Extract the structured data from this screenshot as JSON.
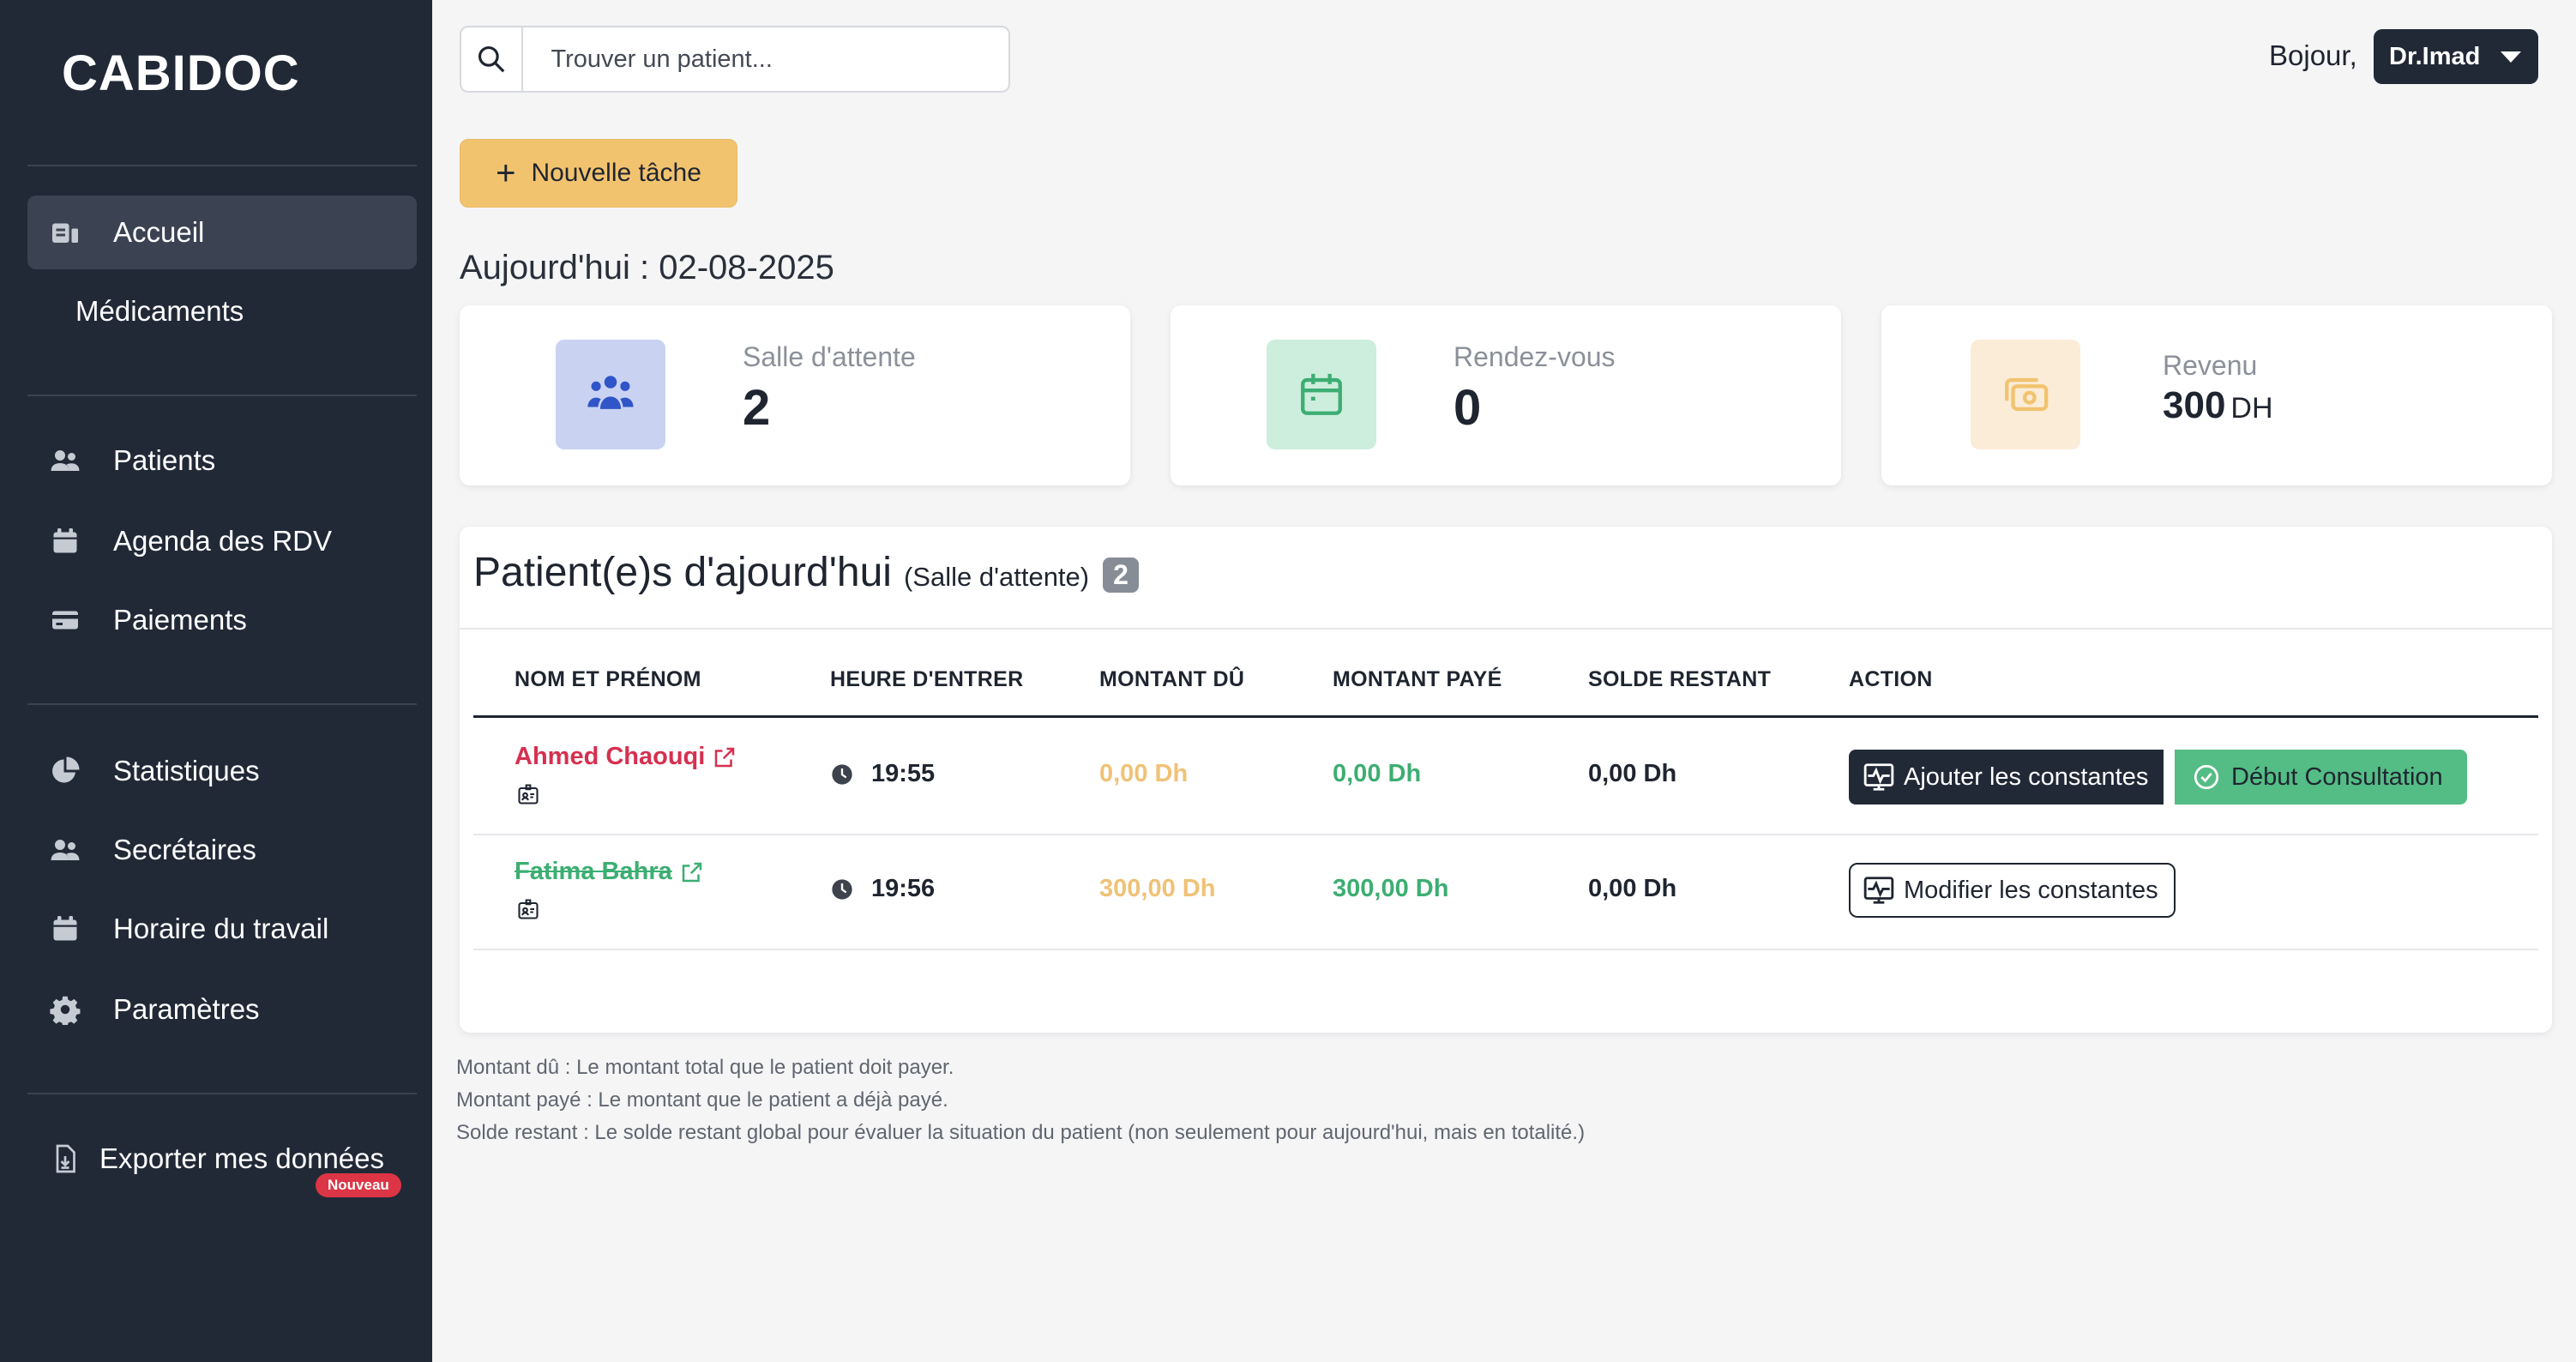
{
  "sidebar": {
    "brand": "CABIDOC",
    "items": [
      {
        "label": "Accueil",
        "icon": "home-card-icon"
      },
      {
        "label": "Médicaments"
      },
      {
        "label": "Patients",
        "icon": "users-icon"
      },
      {
        "label": "Agenda des RDV",
        "icon": "calendar-icon"
      },
      {
        "label": "Paiements",
        "icon": "credit-card-icon"
      },
      {
        "label": "Statistiques",
        "icon": "pie-chart-icon"
      },
      {
        "label": "Secrétaires",
        "icon": "users-icon"
      },
      {
        "label": "Horaire du travail",
        "icon": "calendar-icon"
      },
      {
        "label": "Paramètres",
        "icon": "gear-icon"
      },
      {
        "label": "Exporter mes données",
        "icon": "file-download-icon",
        "badge": "Nouveau"
      }
    ]
  },
  "topbar": {
    "search_placeholder": "Trouver un patient...",
    "greeting": "Bojour,",
    "user": "Dr.Imad"
  },
  "actions": {
    "new_task": "Nouvelle tâche"
  },
  "today_label": "Aujourd'hui : 02-08-2025",
  "stats": [
    {
      "label": "Salle d'attente",
      "value": "2",
      "icon": "users-group-icon",
      "bg": "#c9d3f1",
      "fg": "#2f55c8"
    },
    {
      "label": "Rendez-vous",
      "value": "0",
      "icon": "calendar-icon",
      "bg": "#cdeedd",
      "fg": "#3cae72"
    },
    {
      "label": "Revenu",
      "value": "300",
      "unit": "DH",
      "icon": "money-icon",
      "bg": "#fbecd8",
      "fg": "#f2c36f"
    }
  ],
  "panel": {
    "title": "Patient(e)s d'ajourd'hui",
    "subtitle": "(Salle d'attente)",
    "count": "2",
    "columns": [
      "NOM ET PRÉNOM",
      "HEURE D'ENTRER",
      "MONTANT DÛ",
      "MONTANT PAYÉ",
      "SOLDE RESTANT",
      "ACTION"
    ],
    "rows": [
      {
        "name": "Ahmed Chaouqi",
        "time": "19:55",
        "due": "0,00 Dh",
        "paid": "0,00 Dh",
        "rest": "0,00 Dh",
        "action1": "Ajouter les constantes",
        "action2": "Début Consultation",
        "done": false
      },
      {
        "name": "Fatima Bahra",
        "time": "19:56",
        "due": "300,00 Dh",
        "paid": "300,00 Dh",
        "rest": "0,00 Dh",
        "action1": "Modifier les constantes",
        "done": true
      }
    ]
  },
  "notes": [
    "Montant dû : Le montant total que le patient doit payer.",
    "Montant payé : Le montant que le patient a déjà payé.",
    "Solde restant : Le solde restant global pour évaluer la situation du patient (non seulement pour aujourd'hui, mais en totalité.)"
  ]
}
